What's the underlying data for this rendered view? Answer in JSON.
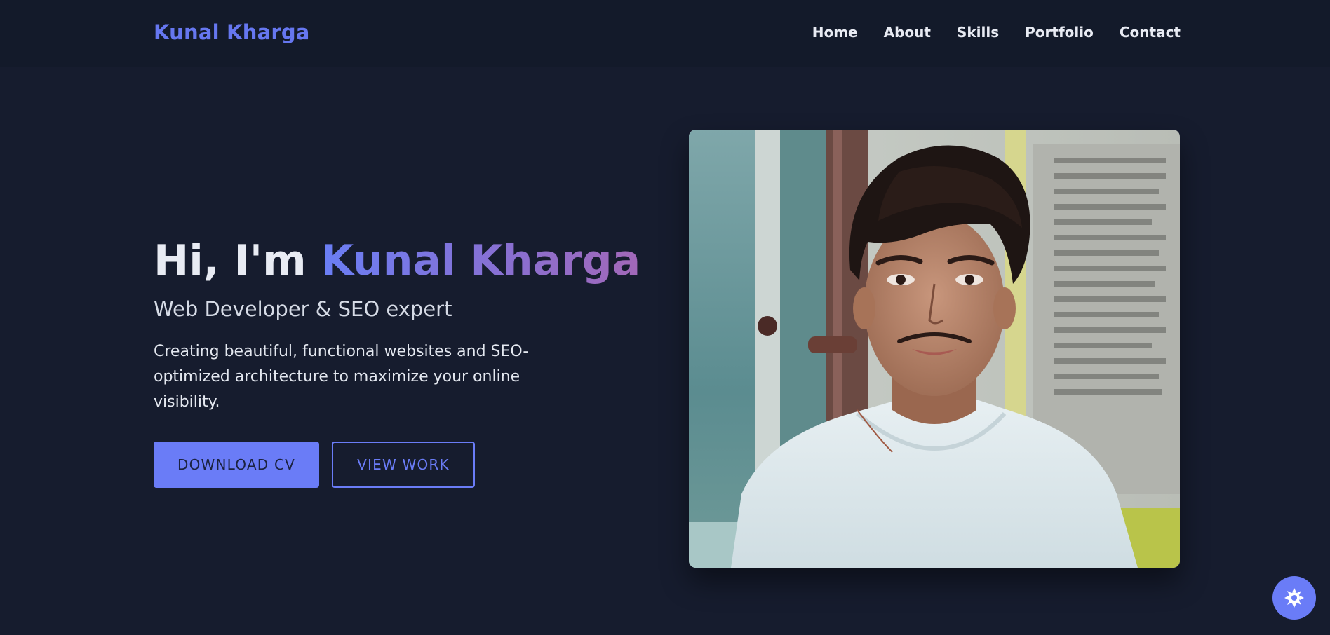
{
  "navbar": {
    "brand": "Kunal Kharga",
    "links": [
      "Home",
      "About",
      "Skills",
      "Portfolio",
      "Contact"
    ]
  },
  "hero": {
    "greeting": "Hi, I'm ",
    "name": "Kunal Kharga",
    "subtitle": "Web Developer & SEO expert",
    "description": "Creating beautiful, functional websites and SEO-optimized architecture to maximize your online visibility.",
    "primary_button": "DOWNLOAD CV",
    "secondary_button": "VIEW WORK"
  },
  "theme_toggle": {
    "icon": "sun-icon"
  },
  "colors": {
    "background": "#161c2d",
    "navbar": "#131a2a",
    "accent": "#6a7cf7",
    "accent_purple": "#a268b8",
    "text": "#e8ebf3"
  }
}
